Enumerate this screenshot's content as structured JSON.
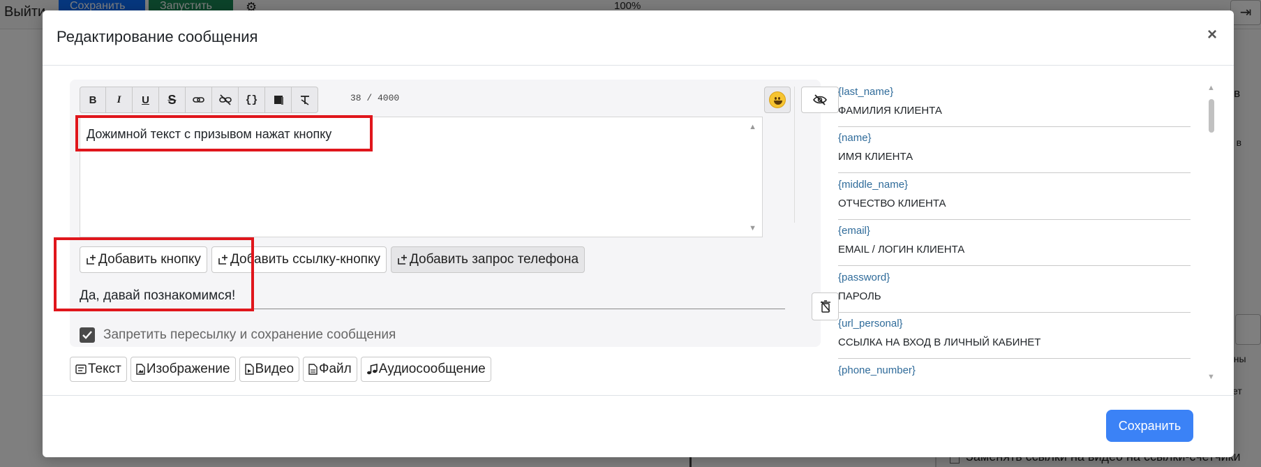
{
  "background": {
    "exit_label": "Выйти",
    "save_label": "Сохранить",
    "run_label": "Запустить",
    "zoom": "100%",
    "side_text_1": "е в",
    "side_text_2": "а в",
    "side_text_3": "аны",
    "side_text_4": "ет",
    "checkbox_label": "Заменять ссылки на видео на ссылки-счетчики"
  },
  "modal": {
    "title": "Редактирование сообщения",
    "close_label": "×",
    "save_label": "Сохранить"
  },
  "toolbar": {
    "counter": "38 / 4000",
    "buttons": [
      "bold-icon",
      "italic-icon",
      "underline-icon",
      "strikethrough-icon",
      "link-icon",
      "unlink-icon",
      "code-icon",
      "spoiler-icon",
      "clear-format-icon"
    ]
  },
  "editor": {
    "text": "Дожимной текст с призывом нажат кнопку"
  },
  "add_buttons": {
    "add_button": "Добавить кнопку",
    "add_link_button": "Добавить ссылку-кнопку",
    "add_phone_request": "Добавить запрос телефона"
  },
  "inline_button": {
    "text": "Да, давай познакомимся!"
  },
  "forward_block": {
    "label": "Запретить пересылку и сохранение сообщения",
    "checked": true
  },
  "types": {
    "text": "Текст",
    "image": "Изображение",
    "video": "Видео",
    "file": "Файл",
    "audio": "Аудиосообщение"
  },
  "variables": [
    {
      "key": "{last_name}",
      "value": "ФАМИЛИЯ КЛИЕНТА"
    },
    {
      "key": "{name}",
      "value": "ИМЯ КЛИЕНТА"
    },
    {
      "key": "{middle_name}",
      "value": "ОТЧЕСТВО КЛИЕНТА"
    },
    {
      "key": "{email}",
      "value": "EMAIL / ЛОГИН КЛИЕНТА"
    },
    {
      "key": "{password}",
      "value": "ПАРОЛЬ"
    },
    {
      "key": "{url_personal}",
      "value": "ССЫЛКА НА ВХОД В ЛИЧНЫЙ КАБИНЕТ"
    },
    {
      "key": "{phone_number}",
      "value": ""
    }
  ],
  "colors": {
    "accent": "#3b82f6",
    "annotation": "#e0161c",
    "variable_key": "#2f6b9a"
  }
}
